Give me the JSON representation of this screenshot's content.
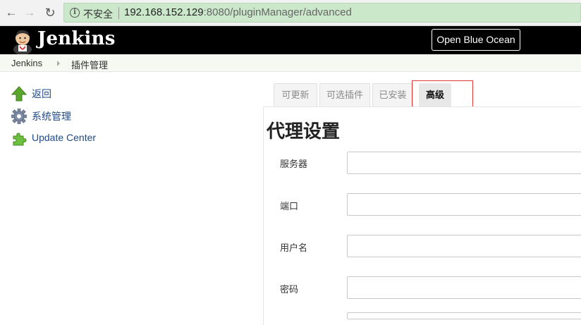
{
  "browser": {
    "security_label": "不安全",
    "url_host": "192.168.152.129",
    "url_rest": ":8080/pluginManager/advanced"
  },
  "header": {
    "title": "Jenkins",
    "blue_ocean_label": "Open Blue Ocean"
  },
  "breadcrumb": {
    "items": [
      "Jenkins",
      "插件管理"
    ]
  },
  "sidebar": {
    "items": [
      {
        "label": "返回",
        "icon": "up-arrow-icon"
      },
      {
        "label": "系统管理",
        "icon": "gear-icon"
      },
      {
        "label": "Update Center",
        "icon": "puzzle-piece-icon"
      }
    ]
  },
  "tabs": [
    {
      "label": "可更新",
      "active": false
    },
    {
      "label": "可选插件",
      "active": false
    },
    {
      "label": "已安装",
      "active": false
    },
    {
      "label": "高级",
      "active": true
    }
  ],
  "proxy": {
    "title": "代理设置",
    "fields": [
      {
        "label": "服务器",
        "value": ""
      },
      {
        "label": "端口",
        "value": ""
      },
      {
        "label": "用户名",
        "value": ""
      },
      {
        "label": "密码",
        "value": ""
      }
    ]
  },
  "colors": {
    "header_bg": "#000000",
    "url_bar_bg": "#cbe8cb",
    "link": "#204a87",
    "highlight_box": "#e23b3b"
  }
}
